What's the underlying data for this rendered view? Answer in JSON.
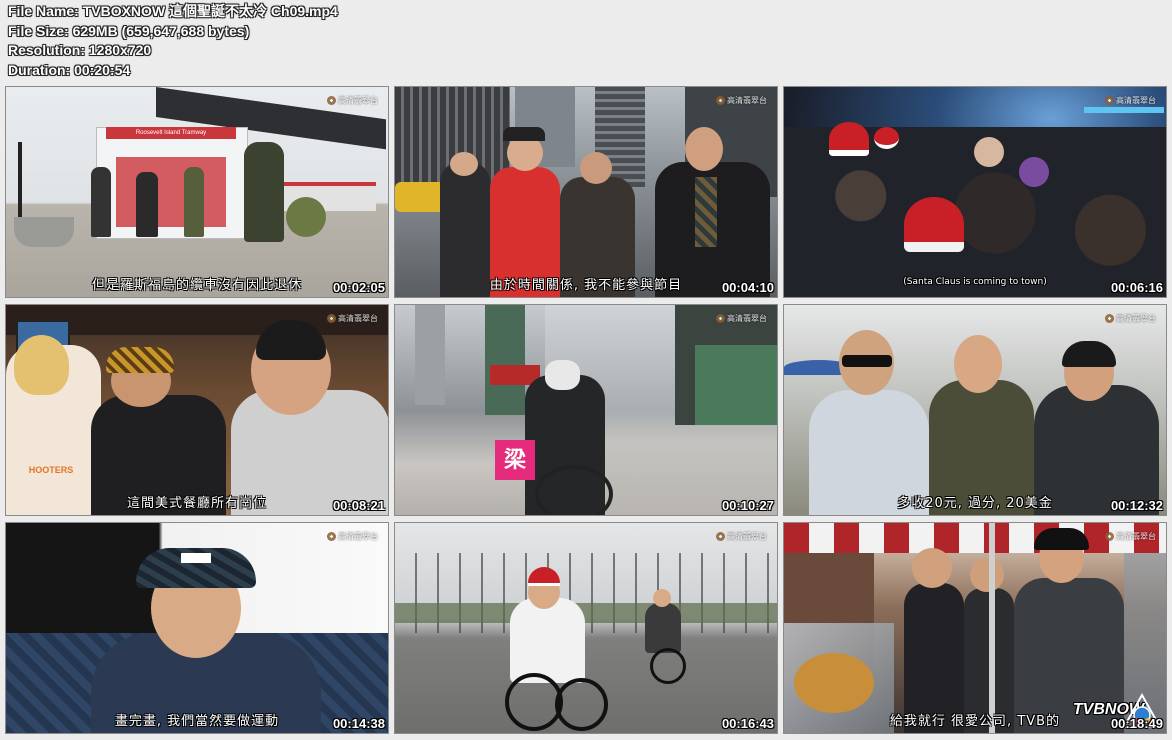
{
  "meta": {
    "file_name": "File Name: TVBOXNOW 這個聖誕不太冷 Ch09.mp4",
    "file_size": "File Size: 629MB (659,647,688 bytes)",
    "resolution": "Resolution: 1280x720",
    "duration": "Duration: 00:20:54"
  },
  "channel_label": "高清翡翠台",
  "watermark": "TVBNOW",
  "thumbnails": [
    {
      "timestamp": "00:02:05",
      "subtitle": "但是羅斯福島的纜車沒有因此退休",
      "sign": "Roosevelt Island Tramway"
    },
    {
      "timestamp": "00:04:10",
      "subtitle": "由於時間關係, 我不能參與節目"
    },
    {
      "timestamp": "00:06:16",
      "subtitle": "(Santa Claus is coming to town)"
    },
    {
      "timestamp": "00:08:21",
      "subtitle": "這間美式餐廳所有崗位",
      "shirt": "HOOTERS"
    },
    {
      "timestamp": "00:10:27",
      "subtitle": "",
      "badge": "梁"
    },
    {
      "timestamp": "00:12:32",
      "subtitle": "多收20元, 過分, 20美金"
    },
    {
      "timestamp": "00:14:38",
      "subtitle": "畫完畫, 我們當然要做運動"
    },
    {
      "timestamp": "00:16:43",
      "subtitle": ""
    },
    {
      "timestamp": "00:18:49",
      "subtitle": "給我就行   很愛公司, TVB的"
    }
  ]
}
